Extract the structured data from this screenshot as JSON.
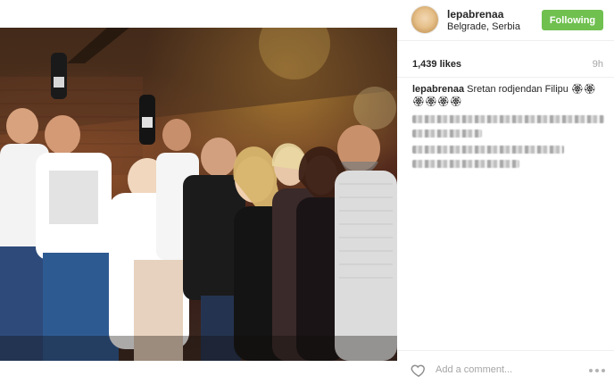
{
  "post": {
    "image_alt_icon": "party-photo-icon",
    "username": "lepabrenaa",
    "location": "Belgrade, Serbia",
    "follow_label": "Following",
    "likes": "1,439 likes",
    "time": "9h",
    "caption_user": "lepabrenaa",
    "caption_text": "Sretan rodjendan Filipu 🏵🏵🏵🏵🏵🏵",
    "comment_placeholder": "Add a comment...",
    "colors": {
      "follow_bg": "#70c050",
      "muted": "#a5a5a5"
    }
  }
}
